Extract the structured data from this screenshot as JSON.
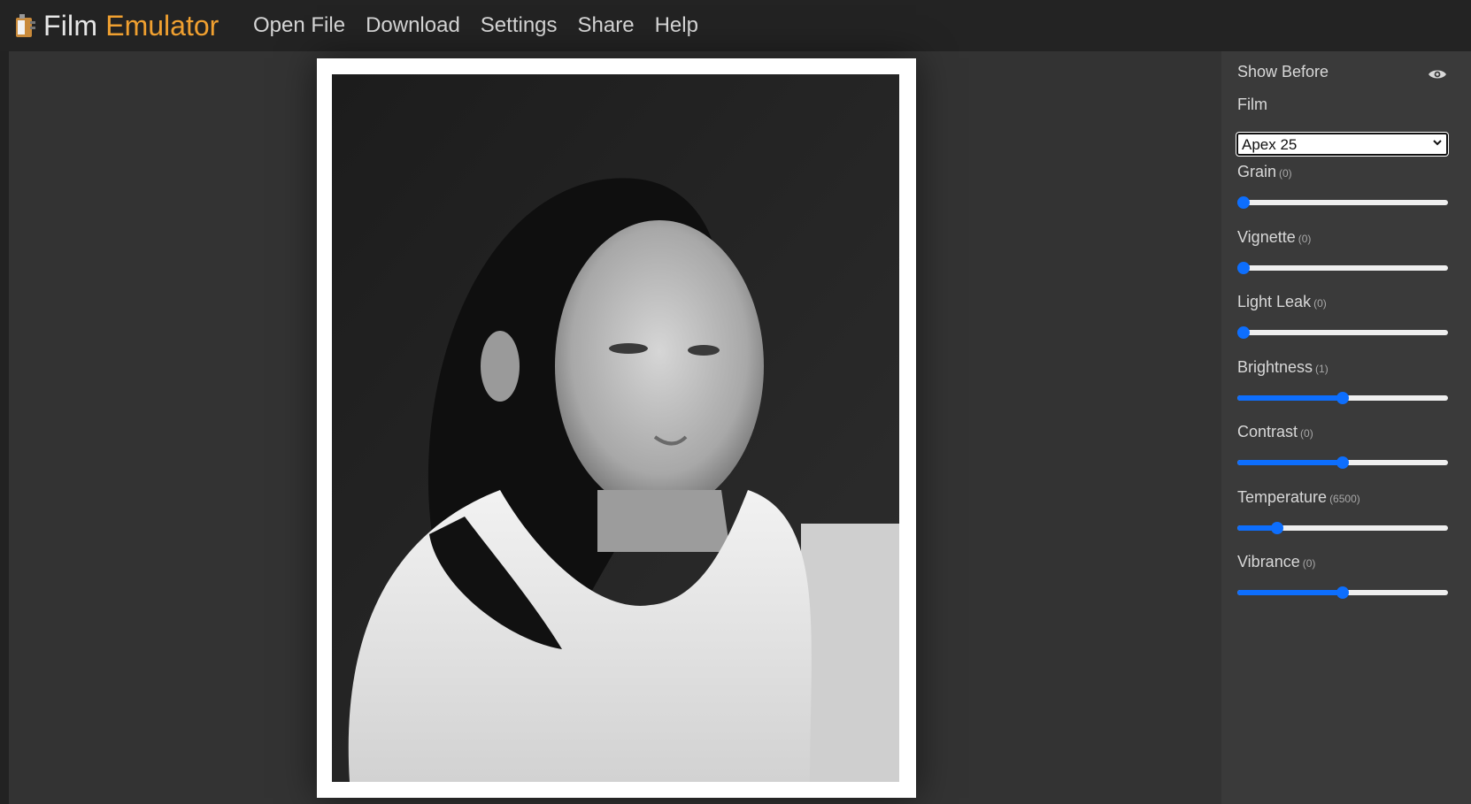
{
  "app": {
    "name": "Film",
    "name_accent": "Emulator"
  },
  "nav": [
    {
      "label": "Open File"
    },
    {
      "label": "Download"
    },
    {
      "label": "Settings"
    },
    {
      "label": "Share"
    },
    {
      "label": "Help"
    }
  ],
  "panel": {
    "show_before_label": "Show Before",
    "film_label": "Film",
    "film_selected": "Apex 25",
    "sliders": [
      {
        "label": "Grain",
        "value": "(0)",
        "fraction": 0
      },
      {
        "label": "Vignette",
        "value": "(0)",
        "fraction": 0
      },
      {
        "label": "Light Leak",
        "value": "(0)",
        "fraction": 0
      },
      {
        "label": "Brightness",
        "value": "(1)",
        "fraction": 0.5
      },
      {
        "label": "Contrast",
        "value": "(0)",
        "fraction": 0.5
      },
      {
        "label": "Temperature",
        "value": "(6500)",
        "fraction": 0.17
      },
      {
        "label": "Vibrance",
        "value": "(0)",
        "fraction": 0.5
      }
    ]
  },
  "colors": {
    "accent": "#f0a030",
    "slider": "#0d6efd"
  },
  "icons": {
    "logo": "film-canister-icon",
    "eye": "eye-icon",
    "caret": "chevron-down-icon"
  }
}
